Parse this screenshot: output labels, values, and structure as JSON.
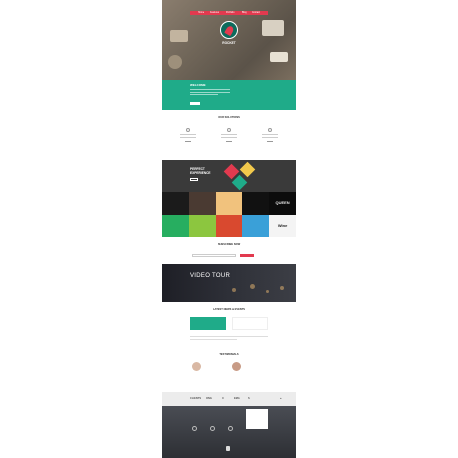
{
  "nav": {
    "items": [
      "Home",
      "Features",
      "Portfolio",
      "Blog",
      "Contact"
    ]
  },
  "hero": {
    "brand": "ROCKET",
    "tagline": ""
  },
  "welcome": {
    "title": "WELCOME",
    "stats": [
      {
        "label": "",
        "value": ""
      },
      {
        "label": "",
        "value": ""
      },
      {
        "label": "",
        "value": ""
      }
    ]
  },
  "solutions": {
    "title": "OUR SOLUTIONS"
  },
  "experience": {
    "title_line1": "PERFECT",
    "title_line2": "EXPERIENCE"
  },
  "portfolio": {
    "tiles": [
      {
        "label": "",
        "color": "#1b1b1b",
        "text_color": "#fff"
      },
      {
        "label": "",
        "color": "#4a3a32",
        "text_color": "#fff"
      },
      {
        "label": "",
        "color": "#f1c27d",
        "text_color": "#333"
      },
      {
        "label": "",
        "color": "#111",
        "text_color": "#fff"
      },
      {
        "label": "QUEEN",
        "color": "#0c0c0c",
        "text_color": "#e9e9e9"
      },
      {
        "label": "",
        "color": "#27ae60",
        "text_color": "#fff"
      },
      {
        "label": "",
        "color": "#8cc63f",
        "text_color": "#fff"
      },
      {
        "label": "",
        "color": "#d9492f",
        "text_color": "#fff"
      },
      {
        "label": "",
        "color": "#3aa0d8",
        "text_color": "#fff"
      },
      {
        "label": "Wine",
        "color": "#f4f4f4",
        "text_color": "#222"
      }
    ]
  },
  "subscribe": {
    "title": "SUBSCRIBE NOW"
  },
  "video": {
    "title": "VIDEO TOUR"
  },
  "news": {
    "title": "LATEST NEWS & EVENTS"
  },
  "testimonials": {
    "title": "TESTIMONIALS"
  },
  "clients": {
    "logos": [
      "CLIENTS",
      "ONG",
      "X",
      "EMA",
      "S",
      "",
      "●"
    ]
  },
  "colors": {
    "primary": "#1fab89",
    "accent": "#e23a4f",
    "dark": "#3a3a3a"
  }
}
